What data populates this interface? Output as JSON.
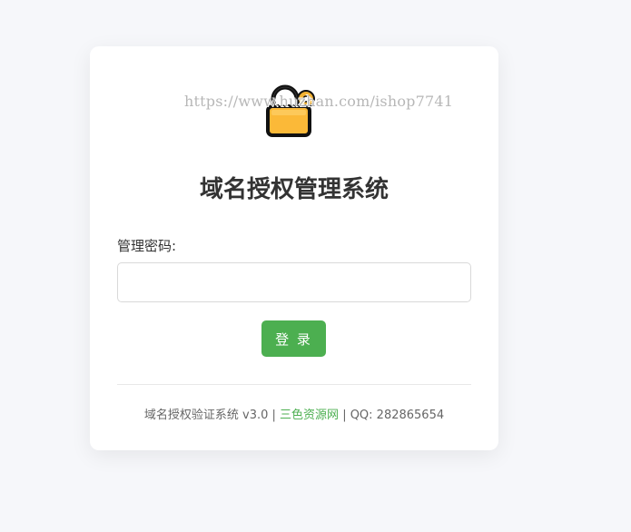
{
  "watermark": "https://www.huzhan.com/ishop7741",
  "title": "域名授权管理系统",
  "form": {
    "password_label": "管理密码:",
    "password_value": "",
    "password_placeholder": "",
    "login_label": "登 录"
  },
  "footer": {
    "system_text": "域名授权验证系统 v3.0 |",
    "link_text": "三色资源网",
    "contact_text": "| QQ: 282865654"
  },
  "icons": {
    "logo": "padlock-icon"
  },
  "colors": {
    "accent": "#4caf50",
    "background": "#f6f7fa",
    "lock_body": "#fbb938"
  }
}
